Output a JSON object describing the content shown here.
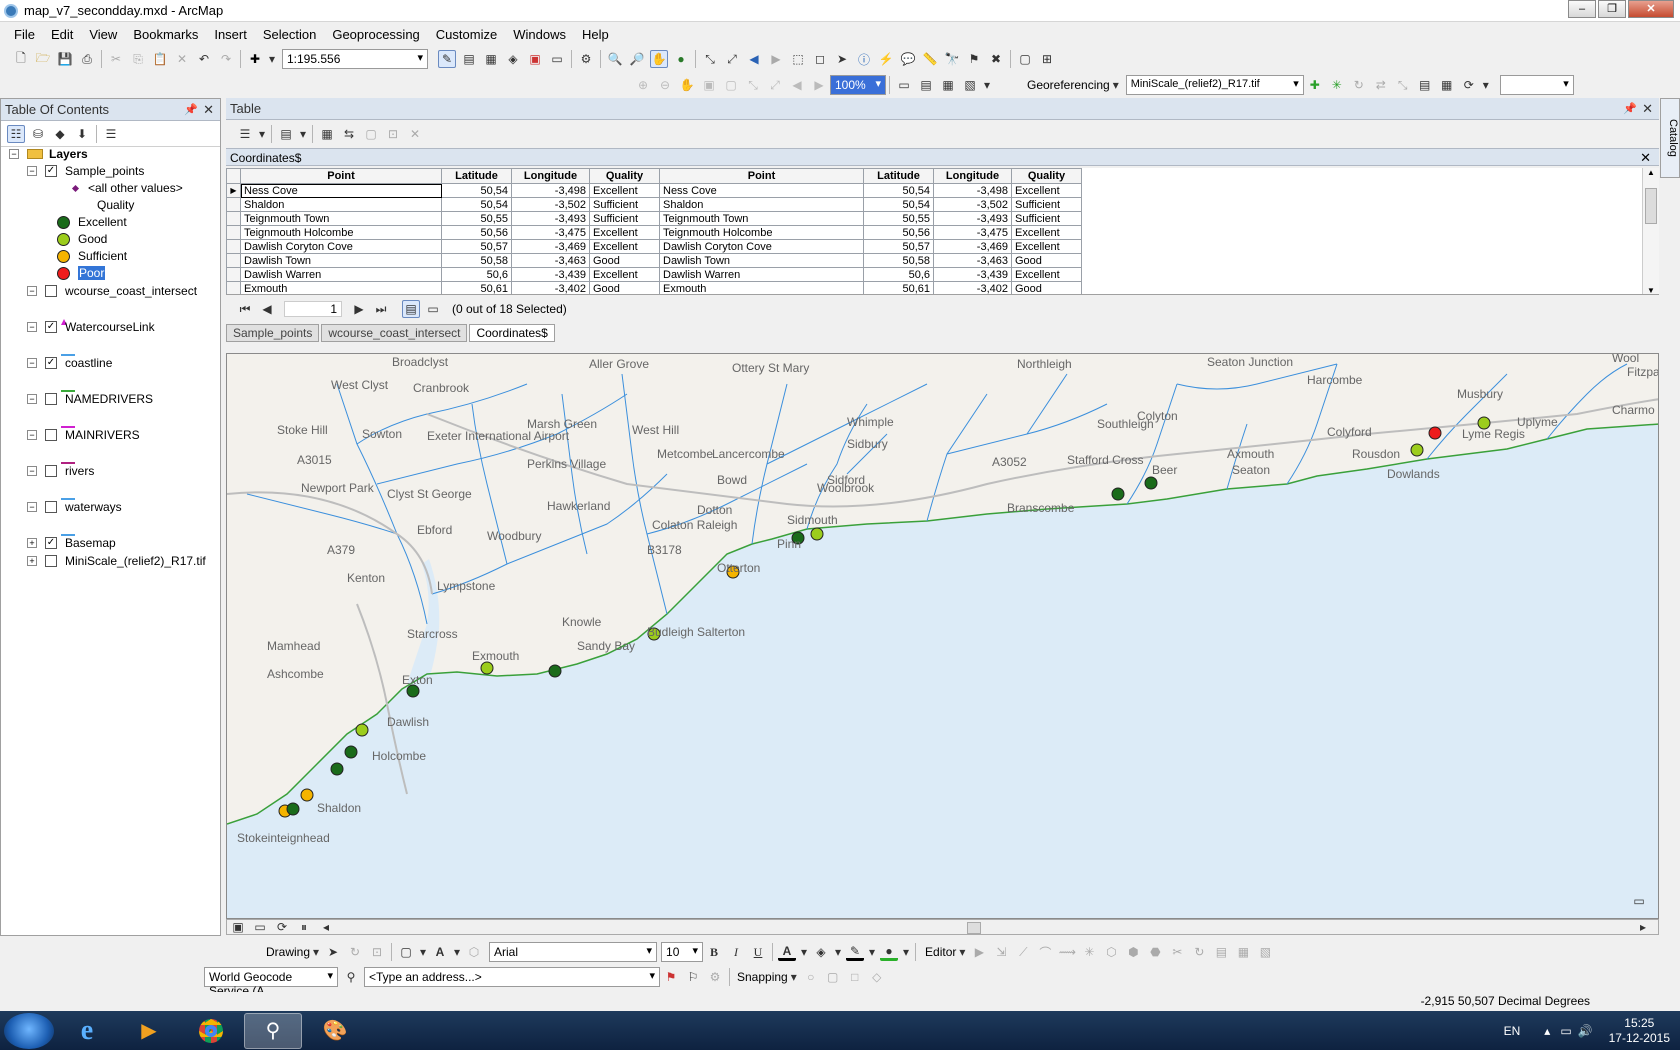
{
  "window": {
    "title": "map_v7_secondday.mxd - ArcMap"
  },
  "menu": [
    "File",
    "Edit",
    "View",
    "Bookmarks",
    "Insert",
    "Selection",
    "Geoprocessing",
    "Customize",
    "Windows",
    "Help"
  ],
  "toolbar": {
    "scale": "1:195.556",
    "zoom_percent": "100%",
    "georeferencing_label": "Georeferencing",
    "georef_layer": "MiniScale_(relief2)_R17.tif"
  },
  "toc": {
    "title": "Table Of Contents",
    "layers_label": "Layers",
    "items": [
      {
        "label": "Sample_points",
        "checked": true
      },
      {
        "label": "<all other values>"
      },
      {
        "label": "Quality"
      },
      {
        "label": "Excellent",
        "color": "#1a6b1a"
      },
      {
        "label": "Good",
        "color": "#9ccd1c"
      },
      {
        "label": "Sufficient",
        "color": "#f5b400"
      },
      {
        "label": "Poor",
        "color": "#ee1c1c"
      },
      {
        "label": "wcourse_coast_intersect",
        "checked": false
      },
      {
        "label": "WatercourseLink",
        "checked": true
      },
      {
        "label": "coastline",
        "checked": true
      },
      {
        "label": "NAMEDRIVERS",
        "checked": false
      },
      {
        "label": "MAINRIVERS",
        "checked": false
      },
      {
        "label": "rivers",
        "checked": false
      },
      {
        "label": "waterways",
        "checked": false
      },
      {
        "label": "Basemap",
        "checked": true
      },
      {
        "label": "MiniScale_(relief2)_R17.tif"
      }
    ]
  },
  "table": {
    "panel_title": "Table",
    "name": "Coordinates$",
    "columns": [
      "Point",
      "Latitude",
      "Longitude",
      "Quality",
      "Point",
      "Latitude",
      "Longitude",
      "Quality"
    ],
    "rows": [
      [
        "Ness Cove",
        "50,54",
        "-3,498",
        "Excellent",
        "Ness Cove",
        "50,54",
        "-3,498",
        "Excellent"
      ],
      [
        "Shaldon",
        "50,54",
        "-3,502",
        "Sufficient",
        "Shaldon",
        "50,54",
        "-3,502",
        "Sufficient"
      ],
      [
        "Teignmouth Town",
        "50,55",
        "-3,493",
        "Sufficient",
        "Teignmouth Town",
        "50,55",
        "-3,493",
        "Sufficient"
      ],
      [
        "Teignmouth Holcombe",
        "50,56",
        "-3,475",
        "Excellent",
        "Teignmouth Holcombe",
        "50,56",
        "-3,475",
        "Excellent"
      ],
      [
        "Dawlish Coryton Cove",
        "50,57",
        "-3,469",
        "Excellent",
        "Dawlish Coryton Cove",
        "50,57",
        "-3,469",
        "Excellent"
      ],
      [
        "Dawlish Town",
        "50,58",
        "-3,463",
        "Good",
        "Dawlish Town",
        "50,58",
        "-3,463",
        "Good"
      ],
      [
        "Dawlish Warren",
        "50,6",
        "-3,439",
        "Excellent",
        "Dawlish Warren",
        "50,6",
        "-3,439",
        "Excellent"
      ],
      [
        "Exmouth",
        "50,61",
        "-3,402",
        "Good",
        "Exmouth",
        "50,61",
        "-3,402",
        "Good"
      ]
    ],
    "record_number": "1",
    "selection_status": "(0 out of 18 Selected)",
    "tabs": [
      "Sample_points",
      "wcourse_coast_intersect",
      "Coordinates$"
    ]
  },
  "catalog_label": "Catalog",
  "map": {
    "labels": [
      "Broadclyst",
      "Aller Grove",
      "Ottery St Mary",
      "Northleigh",
      "Seaton Junction",
      "Harcombe",
      "Musbury",
      "Wool",
      "Fitzpa",
      "West Clyst",
      "Cranbrook",
      "Marsh Green",
      "West Hill",
      "Whimple",
      "Colyton",
      "Colyford",
      "Uplyme",
      "Stoke Hill",
      "Sowton",
      "Exeter International Airport",
      "Perkins Village",
      "Metcombe",
      "Lancercombe",
      "Sidbury",
      "Southleigh",
      "A3052",
      "Stafford Cross",
      "Axmouth",
      "Rousdon",
      "Lyme Regis",
      "Charmo",
      "Newport Park",
      "Clyst St George",
      "Hawkerland",
      "Bowd",
      "Sidford",
      "Beer",
      "Seaton",
      "Dowlands",
      "Ebford",
      "Woodbury",
      "Colaton Raleigh",
      "Dotton",
      "Woolbrook",
      "Branscombe",
      "Sidmouth",
      "Kenton",
      "Lympstone",
      "Otterton",
      "Pinn",
      "Starcross",
      "Knowle",
      "Mamhead",
      "Exmouth",
      "Sandy Bay",
      "Budleigh Salterton",
      "Ashcombe",
      "Exton",
      "Dawlish",
      "Holcombe",
      "Shaldon",
      "Stokeinteignhead",
      "A3015",
      "A379",
      "B3178"
    ]
  },
  "drawing_bar": {
    "drawing_label": "Drawing",
    "font": "Arial",
    "size": "10",
    "editor_label": "Editor"
  },
  "geocode_bar": {
    "service": "World Geocode Service (A",
    "address_placeholder": "<Type an address...>",
    "snapping_label": "Snapping"
  },
  "status": {
    "coords": "-2,915  50,507 Decimal Degrees"
  },
  "taskbar": {
    "lang": "EN",
    "time": "15:25",
    "date": "17-12-2015"
  }
}
